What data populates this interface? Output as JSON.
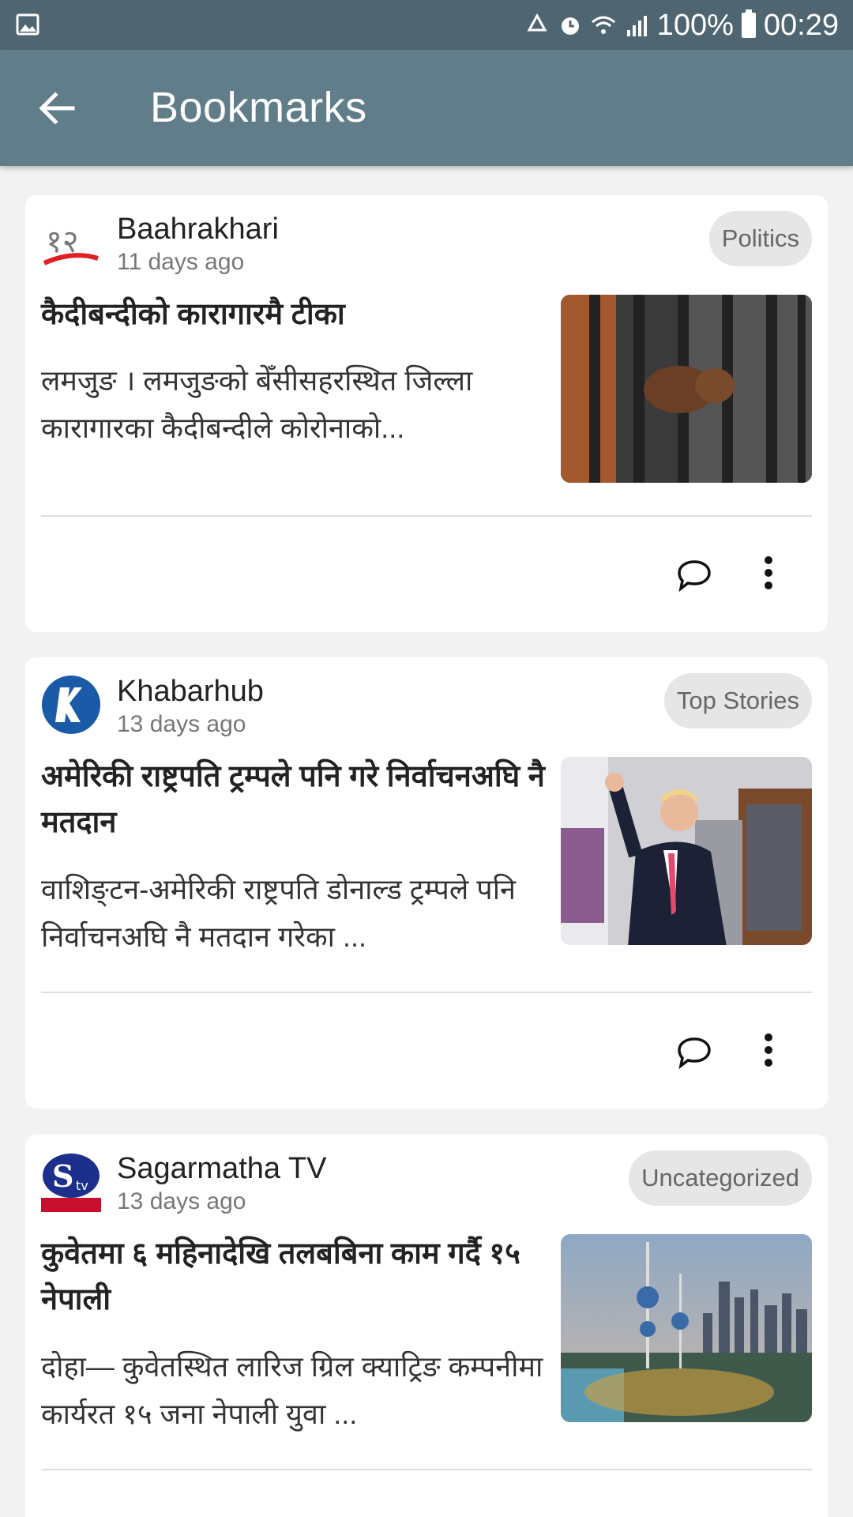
{
  "status_bar": {
    "battery": "100%",
    "time": "00:29",
    "icons": [
      "gallery-icon",
      "recycle-icon",
      "alarm-icon",
      "wifi-icon",
      "signal-icon",
      "battery-icon"
    ]
  },
  "app_bar": {
    "title": "Bookmarks",
    "back_icon": "arrow-left-icon"
  },
  "articles": [
    {
      "source": "Baahrakhari",
      "time": "11 days ago",
      "category": "Politics",
      "headline": "कैदीबन्दीको कारागारमै टीका",
      "description": "लमजुङ । लमजुङको बेँसीसहरस्थित जिल्ला कारागारका कैदीबन्दीले कोरोनाको...",
      "image": "hands-on-prison-bars"
    },
    {
      "source": "Khabarhub",
      "time": "13 days ago",
      "category": "Top Stories",
      "headline": "अमेरिकी राष्ट्रपति ट्रम्पले पनि गरे निर्वाचनअघि नै मतदान",
      "description": "वाशिङ्टन-अमेरिकी राष्ट्रपति डोनाल्ड ट्रम्पले पनि निर्वाचनअघि नै मतदान गरेका ...",
      "image": "man-waving-in-library"
    },
    {
      "source": "Sagarmatha TV",
      "time": "13 days ago",
      "category": "Uncategorized",
      "headline": "कुवेतमा ६ महिनादेखि तलबबिना काम गर्दै १५ नेपाली",
      "description": "दोहा— कुवेतस्थित लारिज ग्रिल क्याट्रिङ कम्पनीमा कार्यरत १५ जना नेपाली युवा ...",
      "image": "kuwait-towers-skyline"
    }
  ],
  "colors": {
    "status_bar": "#4f6672",
    "app_bar": "#617d89",
    "background": "#f2f2f2",
    "card": "#ffffff",
    "badge": "#e6e6e6"
  }
}
